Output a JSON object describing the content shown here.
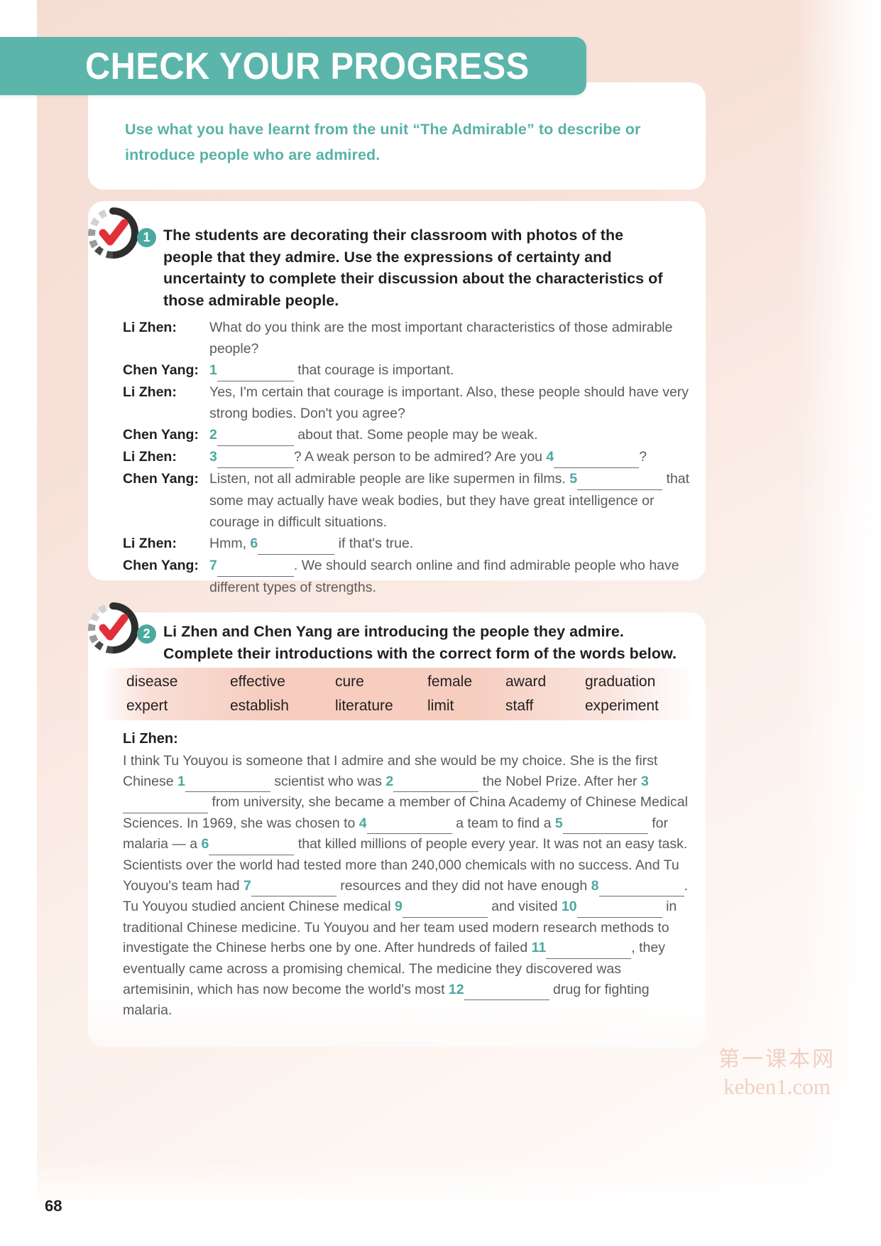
{
  "header": {
    "title": "CHECK YOUR PROGRESS",
    "banner_color": "#5cb5ab"
  },
  "intro": {
    "text": "Use what you have learnt from the unit “The Admirable” to describe or introduce people who are admired.",
    "color": "#58b2a8"
  },
  "tasks": [
    {
      "number": "1",
      "instruction": "The students are decorating their classroom with photos of the people that they admire. Use the expressions of certainty and uncertainty to complete their discussion about the characteristics of those admirable people."
    },
    {
      "number": "2",
      "instruction": "Li Zhen and Chen Yang are introducing the people they admire. Complete their introductions with the correct form of the words below."
    }
  ],
  "dialogue": [
    {
      "speaker": "Li Zhen:",
      "segments": [
        {
          "t": "text",
          "v": "What do you think are the most important characteristics of those admirable people?"
        }
      ]
    },
    {
      "speaker": "Chen Yang:",
      "segments": [
        {
          "t": "num",
          "v": "1"
        },
        {
          "t": "blank",
          "v": "b-sm"
        },
        {
          "t": "text",
          "v": " that courage is important."
        }
      ]
    },
    {
      "speaker": "Li Zhen:",
      "segments": [
        {
          "t": "text",
          "v": "Yes, I'm certain that courage is important. Also, these people should have very strong bodies. Don't you agree?"
        }
      ]
    },
    {
      "speaker": "Chen Yang:",
      "segments": [
        {
          "t": "num",
          "v": "2"
        },
        {
          "t": "blank",
          "v": "b-sm"
        },
        {
          "t": "text",
          "v": " about that. Some people may be weak."
        }
      ]
    },
    {
      "speaker": "Li Zhen:",
      "segments": [
        {
          "t": "num",
          "v": "3"
        },
        {
          "t": "blank",
          "v": "b-sm"
        },
        {
          "t": "text",
          "v": "? A weak person to be admired? Are you "
        },
        {
          "t": "num",
          "v": "4"
        },
        {
          "t": "blank",
          "v": "b-md"
        },
        {
          "t": "text",
          "v": "?"
        }
      ]
    },
    {
      "speaker": "Chen Yang:",
      "segments": [
        {
          "t": "text",
          "v": "Listen, not all admirable people are like supermen in films. "
        },
        {
          "t": "num",
          "v": "5"
        },
        {
          "t": "blank",
          "v": "b-md"
        },
        {
          "t": "text",
          "v": " that some may actually have weak bodies, but they have great intelligence or courage in difficult situations."
        }
      ]
    },
    {
      "speaker": "Li Zhen:",
      "segments": [
        {
          "t": "text",
          "v": "Hmm, "
        },
        {
          "t": "num",
          "v": "6"
        },
        {
          "t": "blank",
          "v": "b-sm"
        },
        {
          "t": "text",
          "v": " if that's true."
        }
      ]
    },
    {
      "speaker": "Chen Yang:",
      "segments": [
        {
          "t": "num",
          "v": "7"
        },
        {
          "t": "blank",
          "v": "b-sm"
        },
        {
          "t": "text",
          "v": ". We should search online and find admirable people who have different types of strengths."
        }
      ]
    }
  ],
  "wordbank": {
    "rows": [
      [
        "disease",
        "effective",
        "cure",
        "female",
        "award",
        "graduation"
      ],
      [
        "expert",
        "establish",
        "literature",
        "limit",
        "staff",
        "experiment"
      ]
    ]
  },
  "passage": {
    "speaker": "Li Zhen:",
    "segments": [
      {
        "t": "text",
        "v": "I think Tu Youyou is someone that I admire and she would be my choice. She is the first Chinese "
      },
      {
        "t": "num",
        "v": "1"
      },
      {
        "t": "blank",
        "v": "b-md"
      },
      {
        "t": "text",
        "v": " scientist who was "
      },
      {
        "t": "num",
        "v": "2"
      },
      {
        "t": "blank",
        "v": "b-md"
      },
      {
        "t": "text",
        "v": " the Nobel Prize. After her "
      },
      {
        "t": "num",
        "v": "3"
      },
      {
        "t": "blank",
        "v": "b-md"
      },
      {
        "t": "text",
        "v": " from university, she became a member of China Academy of Chinese Medical Sciences. In 1969, she was chosen to "
      },
      {
        "t": "num",
        "v": "4"
      },
      {
        "t": "blank",
        "v": "b-md"
      },
      {
        "t": "text",
        "v": " a team to find a "
      },
      {
        "t": "num",
        "v": "5"
      },
      {
        "t": "blank",
        "v": "b-md"
      },
      {
        "t": "text",
        "v": " for malaria — a "
      },
      {
        "t": "num",
        "v": "6"
      },
      {
        "t": "blank",
        "v": "b-md"
      },
      {
        "t": "text",
        "v": " that killed millions of people every year. It was not an easy task. Scientists over the world had tested more than 240,000 chemicals with no success. And Tu Youyou's team had "
      },
      {
        "t": "num",
        "v": "7"
      },
      {
        "t": "blank",
        "v": "b-md"
      },
      {
        "t": "text",
        "v": " resources and they did not have enough "
      },
      {
        "t": "num",
        "v": "8"
      },
      {
        "t": "blank",
        "v": "b-md"
      },
      {
        "t": "text",
        "v": ". Tu Youyou studied ancient Chinese medical "
      },
      {
        "t": "num",
        "v": "9"
      },
      {
        "t": "blank",
        "v": "b-md"
      },
      {
        "t": "text",
        "v": " and visited "
      },
      {
        "t": "num",
        "v": "10"
      },
      {
        "t": "blank",
        "v": "b-md"
      },
      {
        "t": "text",
        "v": " in traditional Chinese medicine. Tu Youyou and her team used modern research methods to investigate the Chinese herbs one by one. After hundreds of failed "
      },
      {
        "t": "num",
        "v": "11"
      },
      {
        "t": "blank",
        "v": "b-md"
      },
      {
        "t": "text",
        "v": ", they eventually came across a promising chemical. The medicine they discovered was artemisinin, which has now become the world's most "
      },
      {
        "t": "num",
        "v": "12"
      },
      {
        "t": "blank",
        "v": "b-md"
      },
      {
        "t": "text",
        "v": " drug for fighting malaria."
      }
    ]
  },
  "footer": {
    "page_number": "68",
    "watermark_cn": "第一课本网",
    "watermark_en": "keben1.com"
  },
  "icons": {
    "check": "check-mark-icon"
  }
}
